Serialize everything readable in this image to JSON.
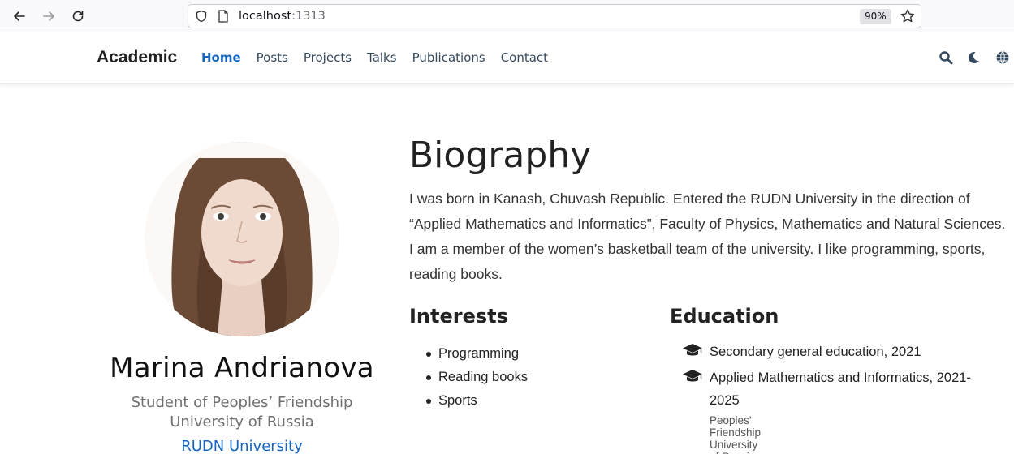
{
  "browser": {
    "url_host": "localhost",
    "url_port": ":1313",
    "zoom": "90%",
    "icons": [
      "back-arrow-icon",
      "forward-arrow-icon",
      "reload-icon",
      "shield-icon",
      "page-icon",
      "bookmark-star-icon"
    ]
  },
  "site": {
    "brand": "Academic",
    "menu": [
      {
        "label": "Home",
        "active": true
      },
      {
        "label": "Posts",
        "active": false
      },
      {
        "label": "Projects",
        "active": false
      },
      {
        "label": "Talks",
        "active": false
      },
      {
        "label": "Publications",
        "active": false
      },
      {
        "label": "Contact",
        "active": false
      }
    ],
    "icons": [
      "search-icon",
      "moon-icon",
      "globe-icon"
    ],
    "accent_color": "#1565c0"
  },
  "profile": {
    "name": "Marina Andrianova",
    "role": "Student of Peoples’ Friendship University of Russia",
    "organization": "RUDN University"
  },
  "biography": {
    "title": "Biography",
    "text": "I was born in Kanash, Chuvash Republic. Entered the RUDN University in the direction of “Applied Mathematics and Informatics”, Faculty of Physics, Mathematics and Natural Sciences. I am a member of the women’s basketball team of the university. I like programming, sports, reading books."
  },
  "interests": {
    "title": "Interests",
    "items": [
      "Programming",
      "Reading books",
      "Sports"
    ]
  },
  "education": {
    "title": "Education",
    "items": [
      {
        "course": "Secondary general education, 2021",
        "institution": ""
      },
      {
        "course": "Applied Mathematics and Informatics, 2021-2025",
        "institution": "Peoples’ Friendship University of Russia"
      }
    ]
  }
}
